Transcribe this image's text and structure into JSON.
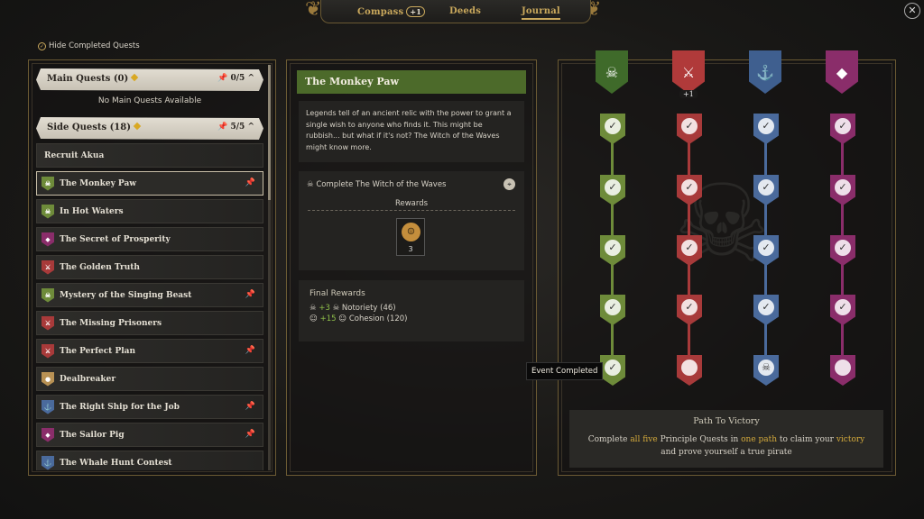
{
  "tabs": {
    "compass": "Compass",
    "compass_badge": "+1",
    "deeds": "Deeds",
    "journal": "Journal"
  },
  "close_glyph": "✕",
  "hide_completed": "Hide Completed Quests",
  "main_quests": {
    "label": "Main Quests",
    "count": "(0)",
    "pinned": "0/5",
    "empty": "No Main Quests Available"
  },
  "side_quests": {
    "label": "Side Quests",
    "count": "(18)",
    "pinned": "5/5",
    "category_row": "Recruit Akua",
    "items": [
      {
        "name": "The Monkey Paw",
        "pinned": true
      },
      {
        "name": "In Hot Waters",
        "pinned": false
      },
      {
        "name": "The Secret of Prosperity",
        "pinned": false
      },
      {
        "name": "The Golden Truth",
        "pinned": false
      },
      {
        "name": "Mystery of the Singing Beast",
        "pinned": true
      },
      {
        "name": "The Missing Prisoners",
        "pinned": false
      },
      {
        "name": "The Perfect Plan",
        "pinned": true
      },
      {
        "name": "Dealbreaker",
        "pinned": false
      },
      {
        "name": "The Right Ship for the Job",
        "pinned": true
      },
      {
        "name": "The Sailor Pig",
        "pinned": true
      },
      {
        "name": "The Whale Hunt Contest",
        "pinned": false
      }
    ]
  },
  "detail": {
    "title": "The Monkey Paw",
    "description": "Legends tell of an ancient relic with the power to grant a single wish to anyone who finds it. This might be rubbish... but what if it's not? The Witch of the Waves might know more.",
    "objective": "Complete The Witch of the Waves",
    "rewards_label": "Rewards",
    "reward_count": "3",
    "final_rewards_label": "Final Rewards",
    "final_rewards": [
      {
        "plus": "+3",
        "label": "Notoriety (46)"
      },
      {
        "plus": "+15",
        "label": "Cohesion (120)"
      }
    ]
  },
  "victory": {
    "plus_badge": "+1",
    "tooltip": "Event Completed",
    "path_title": "Path To Victory",
    "text_a": "Complete ",
    "hl1": "all five",
    "text_b": " Principle Quests in ",
    "hl2": "one path",
    "text_c": " to claim your ",
    "hl3": "victory",
    "text_d": " and prove yourself a true pirate"
  },
  "colors": {
    "green": "#6e8b3a",
    "red": "#a83a3a",
    "blue": "#4a6a9c",
    "purple": "#8a2d6a",
    "gold": "#d4aa3c"
  },
  "icons": [
    "pin-icon",
    "checkmark-icon",
    "skull-icon",
    "location-pin-icon",
    "coin-icon"
  ]
}
